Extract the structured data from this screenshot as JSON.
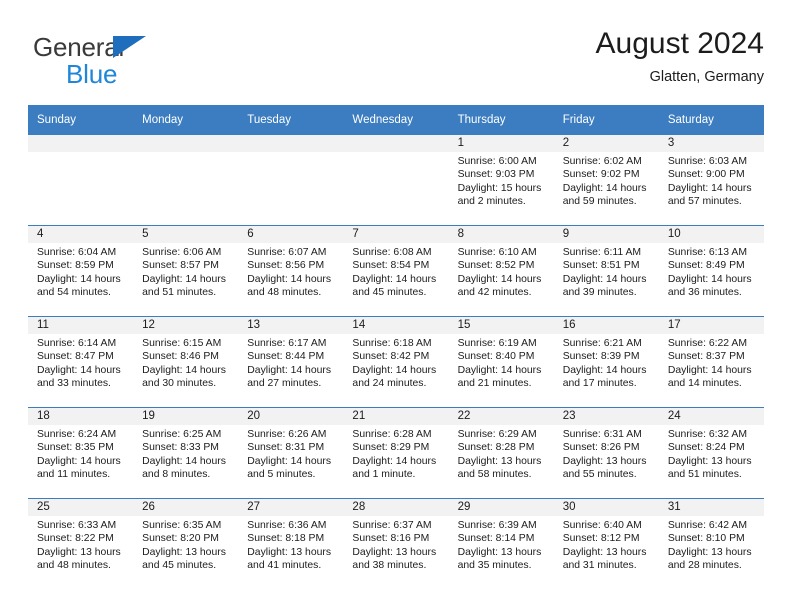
{
  "brand": {
    "line1": "General",
    "line2": "Blue",
    "accent_blue": "#1f6ebd",
    "text_blue": "#1f86d8"
  },
  "header": {
    "title": "August 2024",
    "subtitle": "Glatten, Germany"
  },
  "theme": {
    "header_bg": "#3b7dc0",
    "header_text": "#ffffff",
    "daynum_bg": "#f2f2f2",
    "grid_line": "#3b7dc0"
  },
  "weekday_headers": [
    "Sunday",
    "Monday",
    "Tuesday",
    "Wednesday",
    "Thursday",
    "Friday",
    "Saturday"
  ],
  "labels": {
    "sunrise": "Sunrise:",
    "sunset": "Sunset:",
    "daylight": "Daylight:"
  },
  "weeks": [
    [
      {
        "day": "",
        "sunrise": "",
        "sunset": "",
        "daylight_1": "",
        "daylight_2": ""
      },
      {
        "day": "",
        "sunrise": "",
        "sunset": "",
        "daylight_1": "",
        "daylight_2": ""
      },
      {
        "day": "",
        "sunrise": "",
        "sunset": "",
        "daylight_1": "",
        "daylight_2": ""
      },
      {
        "day": "",
        "sunrise": "",
        "sunset": "",
        "daylight_1": "",
        "daylight_2": ""
      },
      {
        "day": "1",
        "sunrise": "Sunrise: 6:00 AM",
        "sunset": "Sunset: 9:03 PM",
        "daylight_1": "Daylight: 15 hours",
        "daylight_2": "and 2 minutes."
      },
      {
        "day": "2",
        "sunrise": "Sunrise: 6:02 AM",
        "sunset": "Sunset: 9:02 PM",
        "daylight_1": "Daylight: 14 hours",
        "daylight_2": "and 59 minutes."
      },
      {
        "day": "3",
        "sunrise": "Sunrise: 6:03 AM",
        "sunset": "Sunset: 9:00 PM",
        "daylight_1": "Daylight: 14 hours",
        "daylight_2": "and 57 minutes."
      }
    ],
    [
      {
        "day": "4",
        "sunrise": "Sunrise: 6:04 AM",
        "sunset": "Sunset: 8:59 PM",
        "daylight_1": "Daylight: 14 hours",
        "daylight_2": "and 54 minutes."
      },
      {
        "day": "5",
        "sunrise": "Sunrise: 6:06 AM",
        "sunset": "Sunset: 8:57 PM",
        "daylight_1": "Daylight: 14 hours",
        "daylight_2": "and 51 minutes."
      },
      {
        "day": "6",
        "sunrise": "Sunrise: 6:07 AM",
        "sunset": "Sunset: 8:56 PM",
        "daylight_1": "Daylight: 14 hours",
        "daylight_2": "and 48 minutes."
      },
      {
        "day": "7",
        "sunrise": "Sunrise: 6:08 AM",
        "sunset": "Sunset: 8:54 PM",
        "daylight_1": "Daylight: 14 hours",
        "daylight_2": "and 45 minutes."
      },
      {
        "day": "8",
        "sunrise": "Sunrise: 6:10 AM",
        "sunset": "Sunset: 8:52 PM",
        "daylight_1": "Daylight: 14 hours",
        "daylight_2": "and 42 minutes."
      },
      {
        "day": "9",
        "sunrise": "Sunrise: 6:11 AM",
        "sunset": "Sunset: 8:51 PM",
        "daylight_1": "Daylight: 14 hours",
        "daylight_2": "and 39 minutes."
      },
      {
        "day": "10",
        "sunrise": "Sunrise: 6:13 AM",
        "sunset": "Sunset: 8:49 PM",
        "daylight_1": "Daylight: 14 hours",
        "daylight_2": "and 36 minutes."
      }
    ],
    [
      {
        "day": "11",
        "sunrise": "Sunrise: 6:14 AM",
        "sunset": "Sunset: 8:47 PM",
        "daylight_1": "Daylight: 14 hours",
        "daylight_2": "and 33 minutes."
      },
      {
        "day": "12",
        "sunrise": "Sunrise: 6:15 AM",
        "sunset": "Sunset: 8:46 PM",
        "daylight_1": "Daylight: 14 hours",
        "daylight_2": "and 30 minutes."
      },
      {
        "day": "13",
        "sunrise": "Sunrise: 6:17 AM",
        "sunset": "Sunset: 8:44 PM",
        "daylight_1": "Daylight: 14 hours",
        "daylight_2": "and 27 minutes."
      },
      {
        "day": "14",
        "sunrise": "Sunrise: 6:18 AM",
        "sunset": "Sunset: 8:42 PM",
        "daylight_1": "Daylight: 14 hours",
        "daylight_2": "and 24 minutes."
      },
      {
        "day": "15",
        "sunrise": "Sunrise: 6:19 AM",
        "sunset": "Sunset: 8:40 PM",
        "daylight_1": "Daylight: 14 hours",
        "daylight_2": "and 21 minutes."
      },
      {
        "day": "16",
        "sunrise": "Sunrise: 6:21 AM",
        "sunset": "Sunset: 8:39 PM",
        "daylight_1": "Daylight: 14 hours",
        "daylight_2": "and 17 minutes."
      },
      {
        "day": "17",
        "sunrise": "Sunrise: 6:22 AM",
        "sunset": "Sunset: 8:37 PM",
        "daylight_1": "Daylight: 14 hours",
        "daylight_2": "and 14 minutes."
      }
    ],
    [
      {
        "day": "18",
        "sunrise": "Sunrise: 6:24 AM",
        "sunset": "Sunset: 8:35 PM",
        "daylight_1": "Daylight: 14 hours",
        "daylight_2": "and 11 minutes."
      },
      {
        "day": "19",
        "sunrise": "Sunrise: 6:25 AM",
        "sunset": "Sunset: 8:33 PM",
        "daylight_1": "Daylight: 14 hours",
        "daylight_2": "and 8 minutes."
      },
      {
        "day": "20",
        "sunrise": "Sunrise: 6:26 AM",
        "sunset": "Sunset: 8:31 PM",
        "daylight_1": "Daylight: 14 hours",
        "daylight_2": "and 5 minutes."
      },
      {
        "day": "21",
        "sunrise": "Sunrise: 6:28 AM",
        "sunset": "Sunset: 8:29 PM",
        "daylight_1": "Daylight: 14 hours",
        "daylight_2": "and 1 minute."
      },
      {
        "day": "22",
        "sunrise": "Sunrise: 6:29 AM",
        "sunset": "Sunset: 8:28 PM",
        "daylight_1": "Daylight: 13 hours",
        "daylight_2": "and 58 minutes."
      },
      {
        "day": "23",
        "sunrise": "Sunrise: 6:31 AM",
        "sunset": "Sunset: 8:26 PM",
        "daylight_1": "Daylight: 13 hours",
        "daylight_2": "and 55 minutes."
      },
      {
        "day": "24",
        "sunrise": "Sunrise: 6:32 AM",
        "sunset": "Sunset: 8:24 PM",
        "daylight_1": "Daylight: 13 hours",
        "daylight_2": "and 51 minutes."
      }
    ],
    [
      {
        "day": "25",
        "sunrise": "Sunrise: 6:33 AM",
        "sunset": "Sunset: 8:22 PM",
        "daylight_1": "Daylight: 13 hours",
        "daylight_2": "and 48 minutes."
      },
      {
        "day": "26",
        "sunrise": "Sunrise: 6:35 AM",
        "sunset": "Sunset: 8:20 PM",
        "daylight_1": "Daylight: 13 hours",
        "daylight_2": "and 45 minutes."
      },
      {
        "day": "27",
        "sunrise": "Sunrise: 6:36 AM",
        "sunset": "Sunset: 8:18 PM",
        "daylight_1": "Daylight: 13 hours",
        "daylight_2": "and 41 minutes."
      },
      {
        "day": "28",
        "sunrise": "Sunrise: 6:37 AM",
        "sunset": "Sunset: 8:16 PM",
        "daylight_1": "Daylight: 13 hours",
        "daylight_2": "and 38 minutes."
      },
      {
        "day": "29",
        "sunrise": "Sunrise: 6:39 AM",
        "sunset": "Sunset: 8:14 PM",
        "daylight_1": "Daylight: 13 hours",
        "daylight_2": "and 35 minutes."
      },
      {
        "day": "30",
        "sunrise": "Sunrise: 6:40 AM",
        "sunset": "Sunset: 8:12 PM",
        "daylight_1": "Daylight: 13 hours",
        "daylight_2": "and 31 minutes."
      },
      {
        "day": "31",
        "sunrise": "Sunrise: 6:42 AM",
        "sunset": "Sunset: 8:10 PM",
        "daylight_1": "Daylight: 13 hours",
        "daylight_2": "and 28 minutes."
      }
    ]
  ]
}
